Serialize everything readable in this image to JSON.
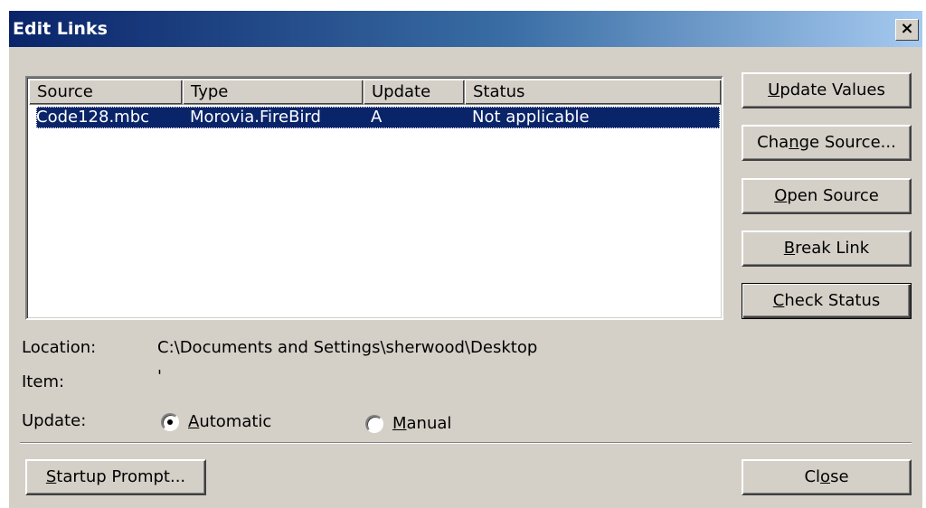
{
  "window": {
    "title": "Edit Links",
    "close_glyph": "×"
  },
  "list": {
    "columns": [
      "Source",
      "Type",
      "Update",
      "Status"
    ],
    "rows": [
      {
        "source": "Code128.mbc",
        "type": "Morovia.FireBird",
        "update": "A",
        "status": "Not applicable"
      }
    ],
    "selected_row": 0
  },
  "buttons": {
    "update_values": {
      "pre": "",
      "key": "U",
      "post": "pdate Values"
    },
    "change_source": {
      "pre": "Cha",
      "key": "n",
      "post": "ge Source..."
    },
    "open_source": {
      "pre": "",
      "key": "O",
      "post": "pen Source"
    },
    "break_link": {
      "pre": "",
      "key": "B",
      "post": "reak Link"
    },
    "check_status": {
      "pre": "",
      "key": "C",
      "post": "heck Status"
    },
    "startup_prompt": {
      "pre": "",
      "key": "S",
      "post": "tartup Prompt..."
    },
    "close": {
      "pre": "Cl",
      "key": "o",
      "post": "se"
    }
  },
  "details": {
    "location_label": "Location:",
    "location_value": "C:\\Documents and Settings\\sherwood\\Desktop",
    "item_label": "Item:",
    "item_value": "'",
    "update_label": "Update:"
  },
  "update_mode": {
    "automatic": {
      "pre": "",
      "key": "A",
      "post": "utomatic",
      "checked": true
    },
    "manual": {
      "pre": "",
      "key": "M",
      "post": "anual",
      "checked": false
    }
  },
  "colors": {
    "title_start": "#0a246a",
    "title_end": "#a6caf0",
    "selection": "#0a246a",
    "face": "#d4d0c8"
  }
}
